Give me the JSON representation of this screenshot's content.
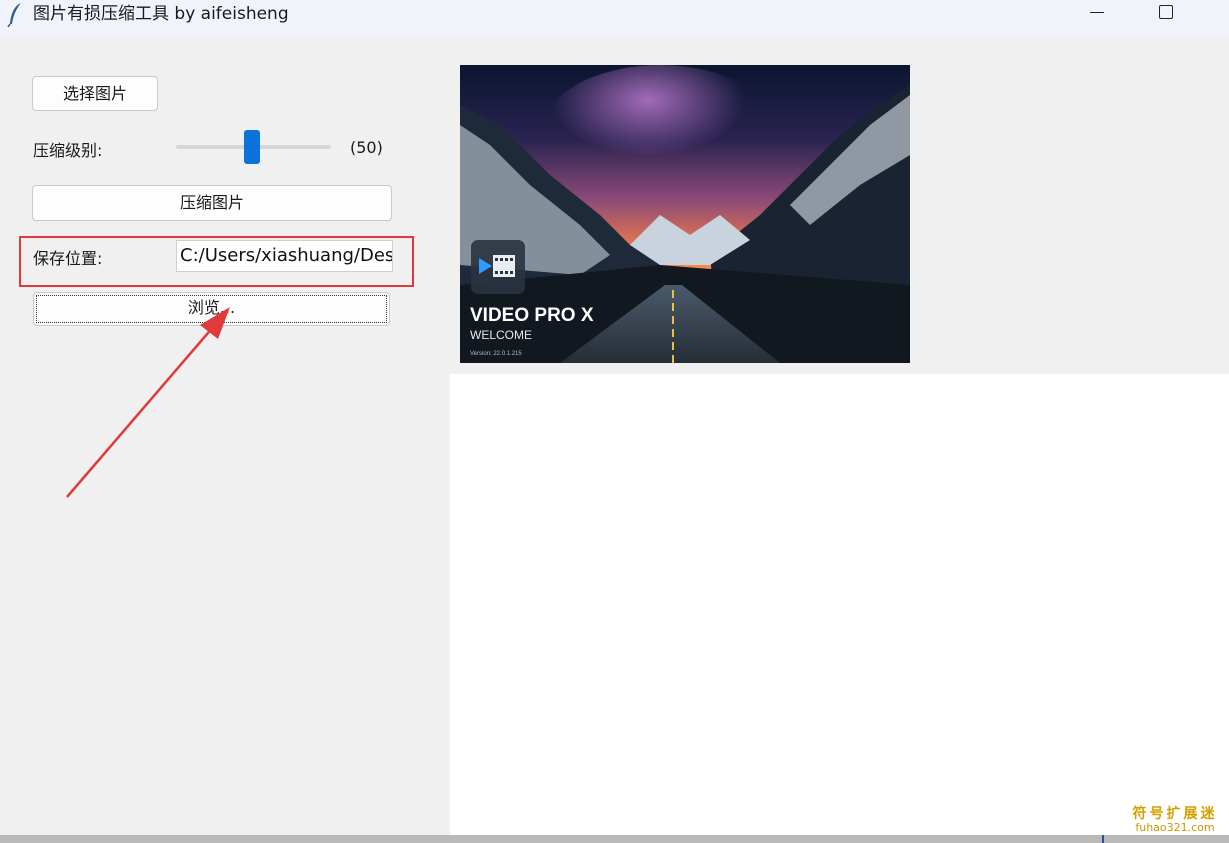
{
  "window": {
    "title": "图片有损压缩工具 by aifeisheng",
    "icon": "feather-icon",
    "controls": [
      "minimize-icon",
      "maximize-icon"
    ]
  },
  "controls": {
    "select_button": "选择图片",
    "compression_label": "压缩级别:",
    "compression_value": 50,
    "compression_value_text": "(50)",
    "compress_button": "压缩图片",
    "save_label": "保存位置:",
    "save_path": "C:/Users/xiashuang/Des",
    "browse_button": "浏览..."
  },
  "preview": {
    "title": "VIDEO PRO X",
    "subtitle": "WELCOME",
    "version": "Version: 22.0.1.215"
  },
  "annotations": {
    "highlight_color": "#e03a3a",
    "arrow_color": "#e03a3a"
  },
  "watermark": {
    "cn": "符号扩展迷",
    "en": "fuhao321.com"
  },
  "colors": {
    "accent": "#0a72d8",
    "background": "#f0f0f0"
  }
}
